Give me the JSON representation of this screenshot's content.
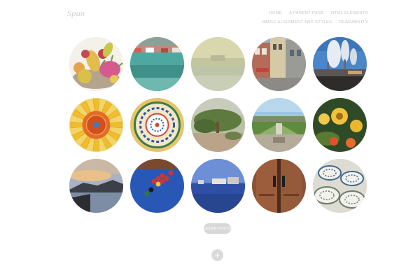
{
  "site": {
    "logo": "Spun"
  },
  "nav": {
    "row1": [
      "HOME",
      "A PARENT PAGE",
      "HTML ELEMENTS"
    ],
    "row2": [
      "IMAGE ALIGNMENT AND STYLES",
      "READABILITY"
    ]
  },
  "gallery": {
    "items": [
      {
        "icon": "fruit-bowl-image"
      },
      {
        "icon": "harbor-boats-image"
      },
      {
        "icon": "misty-lake-image"
      },
      {
        "icon": "old-town-street-image"
      },
      {
        "icon": "industrial-smoke-image"
      },
      {
        "icon": "sunflower-image"
      },
      {
        "icon": "mandala-image"
      },
      {
        "icon": "desert-tree-image"
      },
      {
        "icon": "formal-garden-image"
      },
      {
        "icon": "yellow-flowers-image"
      },
      {
        "icon": "sunset-coast-image"
      },
      {
        "icon": "billiards-table-image"
      },
      {
        "icon": "coastal-city-image"
      },
      {
        "icon": "wooden-door-image"
      },
      {
        "icon": "ceramic-plates-image"
      }
    ]
  },
  "pagination": {
    "older_label": "OLDER POSTS"
  },
  "footer": {
    "plus_label": "+"
  }
}
